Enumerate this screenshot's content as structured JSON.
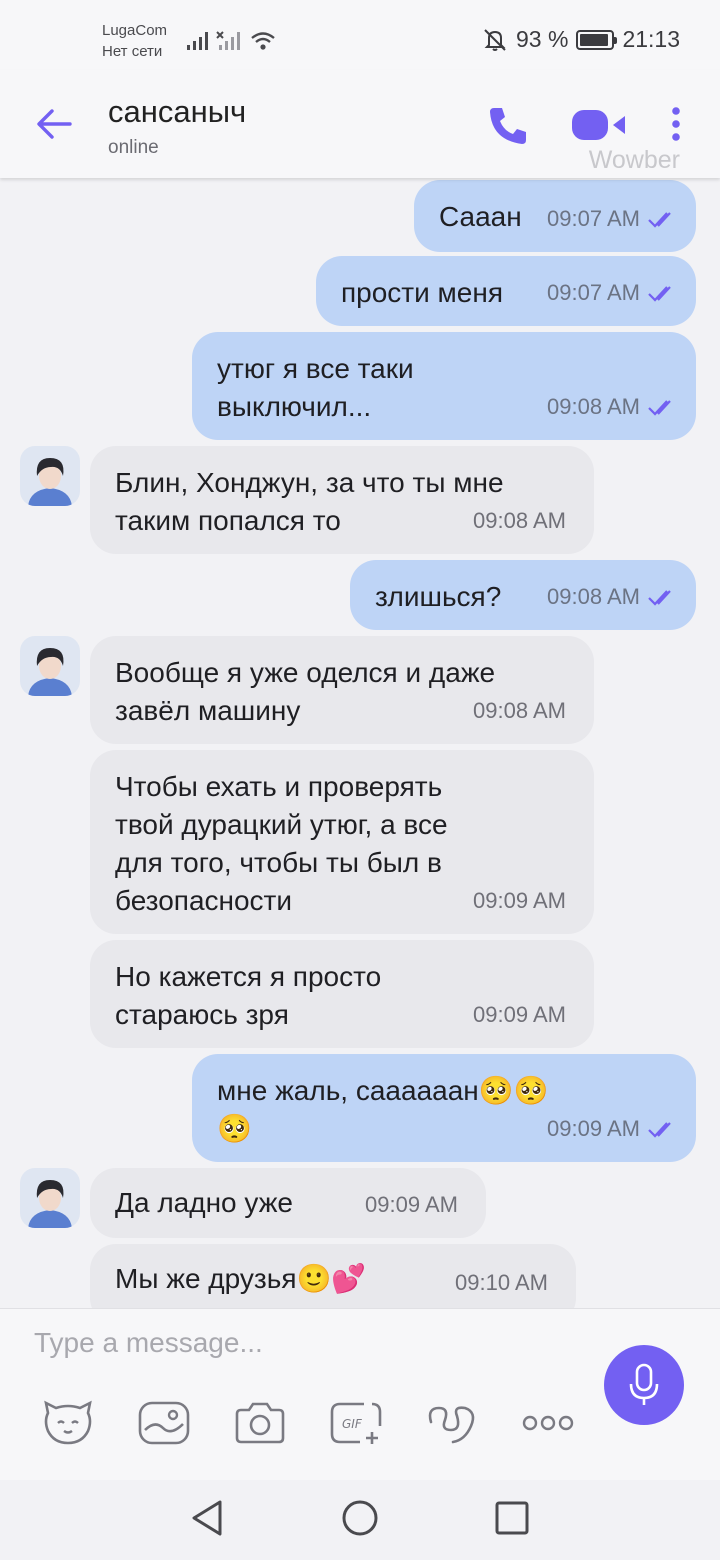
{
  "status_bar": {
    "carrier": "LugaCom",
    "network": "Нет сети",
    "battery": "93 %",
    "battery_level": 0.93,
    "time": "21:13"
  },
  "header": {
    "contact_name": "сансаныч",
    "contact_status": "online",
    "watermark": "Wowber",
    "icons": [
      "back-arrow-icon",
      "phone-icon",
      "video-camera-icon",
      "more-vertical-icon"
    ]
  },
  "messages": [
    {
      "direction": "out",
      "text": "Сааан",
      "time": "09:07 AM"
    },
    {
      "direction": "out",
      "text": "прости меня",
      "time": "09:07 AM"
    },
    {
      "direction": "out",
      "lines": [
        "утюг я все таки",
        "выключил..."
      ],
      "time": "09:08 AM"
    },
    {
      "direction": "in",
      "lines": [
        "Блин, Хонджун, за что ты мне",
        "таким попался то"
      ],
      "time": "09:08 AM"
    },
    {
      "direction": "out",
      "text": "злишься?",
      "time": "09:08 AM"
    },
    {
      "direction": "in",
      "lines": [
        "Вообще я уже оделся и даже",
        "завёл машину"
      ],
      "time": "09:08 AM"
    },
    {
      "direction": "in",
      "lines": [
        "Чтобы ехать и проверять",
        "твой дурацкий утюг, а все",
        "для того, чтобы ты был в",
        "безопасности"
      ],
      "time": "09:09 AM"
    },
    {
      "direction": "in",
      "lines": [
        "Но кажется я просто",
        "стараюсь зря"
      ],
      "time": "09:09 AM"
    },
    {
      "direction": "out",
      "lines": [
        "мне жаль, саааааан🥺🥺",
        "🥺"
      ],
      "time": "09:09 AM"
    },
    {
      "direction": "in",
      "text": "Да ладно уже",
      "time": "09:09 AM"
    },
    {
      "direction": "in",
      "text": "Мы же друзья🙂💕",
      "time": "09:10 AM"
    }
  ],
  "composer": {
    "placeholder": "Type a message...",
    "tools": [
      "sticker-icon",
      "gallery-icon",
      "camera-icon",
      "gif-icon",
      "doodle-icon",
      "more-options-icon"
    ],
    "mic": "microphone-icon"
  },
  "colors": {
    "accent": "#7360f2",
    "outgoing_bubble": "#bed4f6",
    "incoming_bubble": "#e8e8ec",
    "background": "#f2f2f5"
  }
}
